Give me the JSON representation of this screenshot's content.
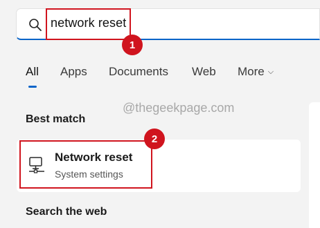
{
  "search": {
    "query": "network reset"
  },
  "annotations": {
    "step1": "1",
    "step2": "2"
  },
  "tabs": [
    {
      "label": "All",
      "active": true
    },
    {
      "label": "Apps",
      "active": false
    },
    {
      "label": "Documents",
      "active": false
    },
    {
      "label": "Web",
      "active": false
    },
    {
      "label": "More",
      "active": false
    }
  ],
  "watermark": "@thegeekpage.com",
  "sections": {
    "best_match": "Best match",
    "search_web": "Search the web"
  },
  "best_match": {
    "title": "Network reset",
    "subtitle": "System settings",
    "icon": "network-computer-icon"
  },
  "colors": {
    "accent": "#0a64c8",
    "annotation_red": "#d0141e",
    "background": "#f3f3f3"
  }
}
